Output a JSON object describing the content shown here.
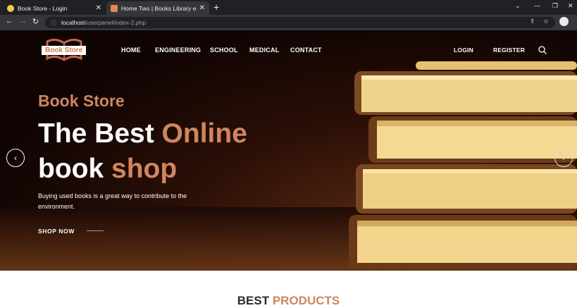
{
  "browser": {
    "tabs": [
      {
        "title": "Book Store - Login",
        "close": "✕"
      },
      {
        "title": "Home Two | Books Library eCom",
        "close": "✕"
      }
    ],
    "new_tab": "+",
    "url_host": "localhost",
    "url_path": "/userpanel/index-2.php"
  },
  "site": {
    "logo_text": "Book Store",
    "nav": [
      "HOME",
      "ENGINEERING",
      "SCHOOL",
      "MEDICAL",
      "CONTACT"
    ],
    "login": "LOGIN",
    "register": "REGISTER"
  },
  "hero": {
    "kicker": "Book Store",
    "line1_white": "The Best ",
    "line1_accent": "Online",
    "line2_white": "book ",
    "line2_accent": "shop",
    "description": "Buying used books is a great way to contribute to the environment.",
    "cta": "SHOP NOW",
    "prev": "‹",
    "next": "›"
  },
  "section": {
    "title_dark": "BEST ",
    "title_accent": "PRODUCTS"
  },
  "colors": {
    "accent": "#d08560",
    "browser_dark": "#202124",
    "browser_toolbar": "#35363a"
  }
}
